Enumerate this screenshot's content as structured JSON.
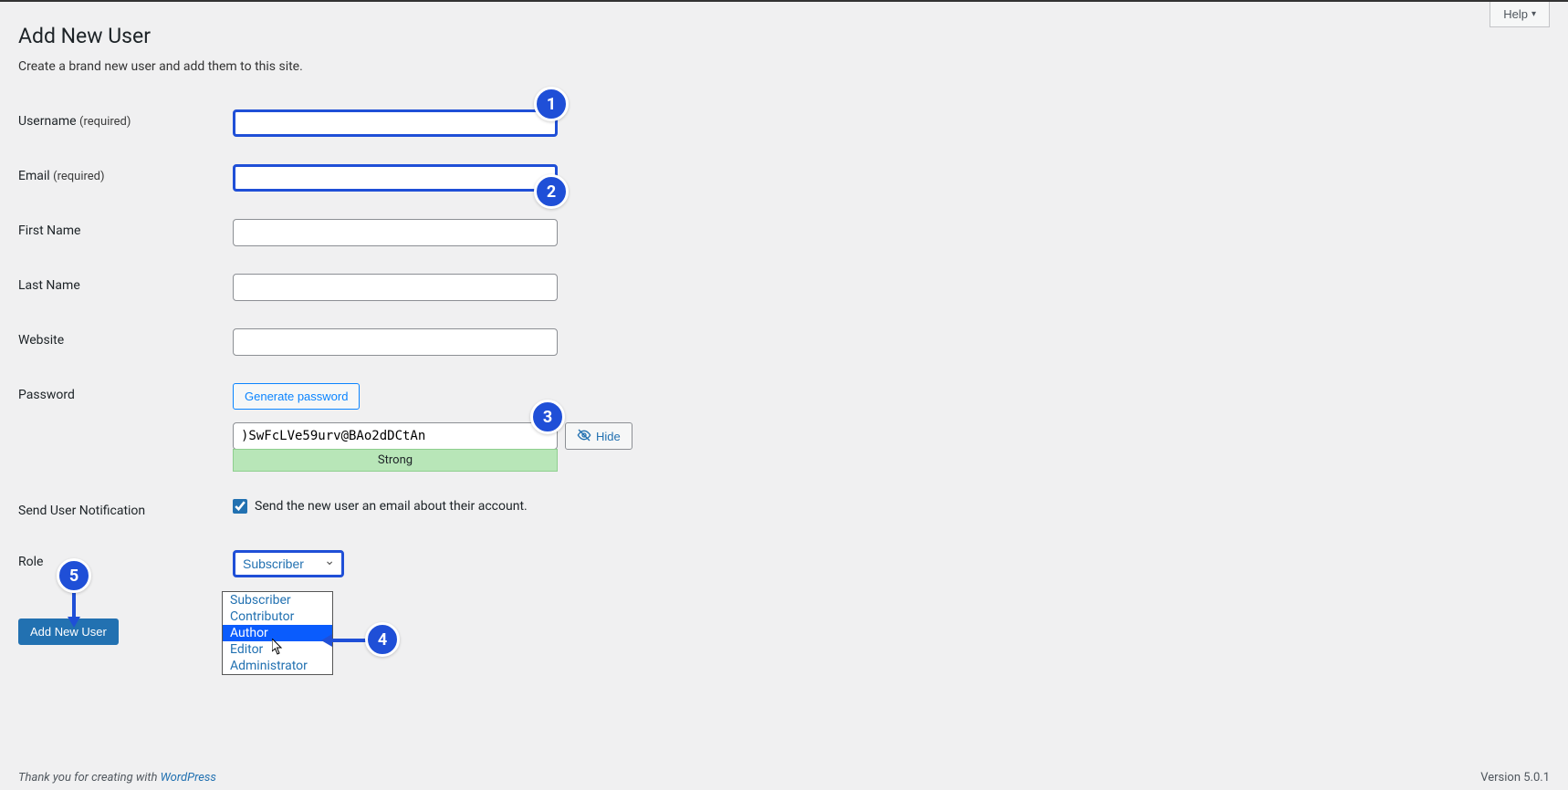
{
  "header": {
    "help_label": "Help",
    "title": "Add New User",
    "subtitle": "Create a brand new user and add them to this site."
  },
  "fields": {
    "username": {
      "label": "Username",
      "required_suffix": "(required)",
      "value": ""
    },
    "email": {
      "label": "Email",
      "required_suffix": "(required)",
      "value": ""
    },
    "first_name": {
      "label": "First Name",
      "value": ""
    },
    "last_name": {
      "label": "Last Name",
      "value": ""
    },
    "website": {
      "label": "Website",
      "value": ""
    },
    "password": {
      "label": "Password",
      "generate_label": "Generate password",
      "value": ")SwFcLVe59urv@BAo2dDCtAn",
      "hide_label": "Hide",
      "strength_label": "Strong"
    },
    "send_notification": {
      "label": "Send User Notification",
      "checkbox_label": "Send the new user an email about their account.",
      "checked": true
    },
    "role": {
      "label": "Role",
      "selected": "Subscriber",
      "options": [
        "Subscriber",
        "Contributor",
        "Author",
        "Editor",
        "Administrator"
      ]
    }
  },
  "submit": {
    "label": "Add New User"
  },
  "annotations": {
    "b1": "1",
    "b2": "2",
    "b3": "3",
    "b4": "4",
    "b5": "5"
  },
  "footer": {
    "thanks_prefix": "Thank you for creating with ",
    "thanks_link": "WordPress",
    "version": "Version 5.0.1"
  }
}
